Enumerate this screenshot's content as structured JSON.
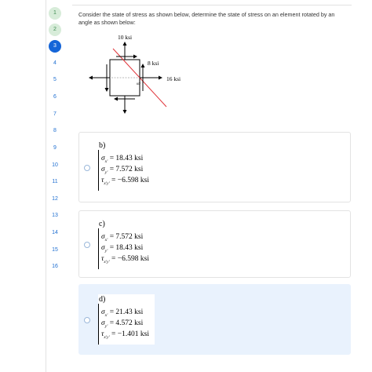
{
  "nav": {
    "items": [
      {
        "label": "1",
        "state": "done"
      },
      {
        "label": "2",
        "state": "done"
      },
      {
        "label": "3",
        "state": "current"
      },
      {
        "label": "4",
        "state": "todo"
      },
      {
        "label": "5",
        "state": "todo"
      },
      {
        "label": "6",
        "state": "todo"
      },
      {
        "label": "7",
        "state": "todo"
      },
      {
        "label": "8",
        "state": "todo"
      },
      {
        "label": "9",
        "state": "todo"
      },
      {
        "label": "10",
        "state": "todo"
      },
      {
        "label": "11",
        "state": "todo"
      },
      {
        "label": "12",
        "state": "todo"
      },
      {
        "label": "13",
        "state": "todo"
      },
      {
        "label": "14",
        "state": "todo"
      },
      {
        "label": "15",
        "state": "todo"
      },
      {
        "label": "16",
        "state": "todo"
      }
    ]
  },
  "question": {
    "text": "Consider the state of stress as shown below, determine the state of stress on an element rotated by an angle as shown below:"
  },
  "diagram": {
    "top_label": "10 ksi",
    "shear_label": "8 ksi",
    "right_label": "16 ksi",
    "angle_label": "60°"
  },
  "options": [
    {
      "label": "b)",
      "selected": false,
      "sx_sym": "σ",
      "sx_sub": "x'",
      "sx_val": " = 18.43 ksi",
      "sy_sym": "σ",
      "sy_sub": "y'",
      "sy_val": " = 7.572 ksi",
      "t_sym": "τ",
      "t_sub": "x'y'",
      "t_val": " = −6.598 ksi"
    },
    {
      "label": "c)",
      "selected": false,
      "sx_sym": "σ",
      "sx_sub": "x'",
      "sx_val": " = 7.572 ksi",
      "sy_sym": "σ",
      "sy_sub": "y'",
      "sy_val": " = 18.43 ksi",
      "t_sym": "τ",
      "t_sub": "x'y'",
      "t_val": " = −6.598 ksi"
    },
    {
      "label": "d)",
      "selected": true,
      "sx_sym": "σ",
      "sx_sub": "x'",
      "sx_val": " = 21.43 ksi",
      "sy_sym": "σ",
      "sy_sub": "y'",
      "sy_val": " = 4.572 ksi",
      "t_sym": "τ",
      "t_sub": "x'y'",
      "t_val": " = −1.401 ksi"
    }
  ],
  "colors": {
    "accent": "#1565d8",
    "done_bg": "#d7ecd9",
    "done_fg": "#3f8a52",
    "selected_bg": "#e9f2fd",
    "cut_line": "#e0343a"
  }
}
